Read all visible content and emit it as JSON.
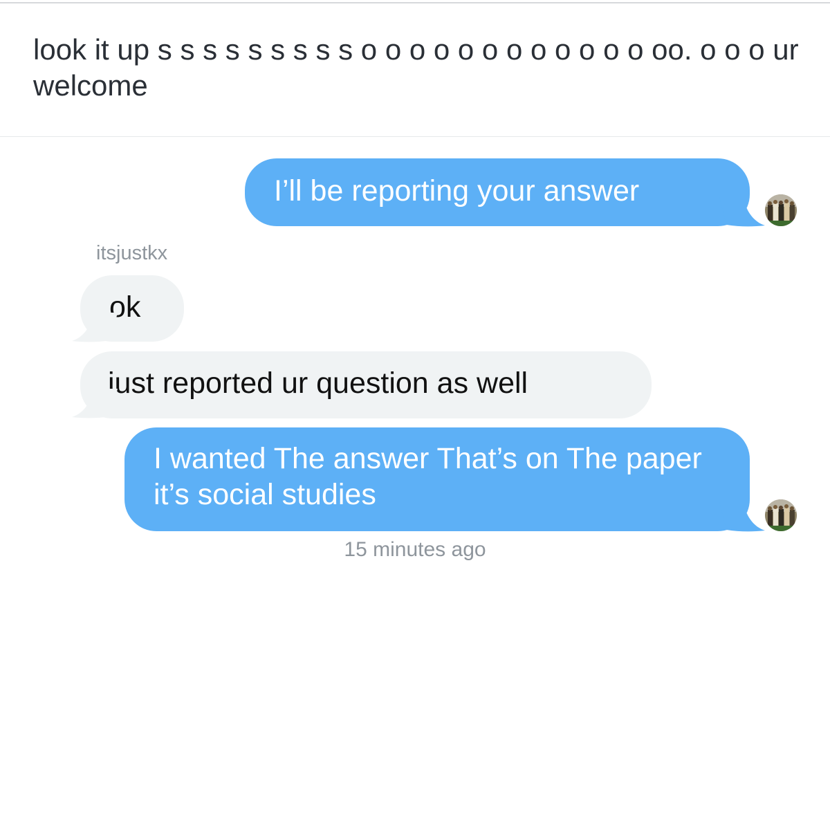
{
  "question": {
    "text": "look it up s s s s s s s s s o o o o o o o o o o o o oo. o o o ur welcome"
  },
  "conversation": {
    "messages": [
      {
        "sender": "me",
        "text": "I’ll be reporting your answer"
      },
      {
        "sender": "itsjustkx",
        "sender_label": "itsjustkx",
        "text": "ok"
      },
      {
        "sender": "itsjustkx",
        "text": "just reported ur question as well"
      },
      {
        "sender": "me",
        "text": "I wanted The answer That’s on The paper it’s social studies"
      }
    ],
    "timestamp": "15 minutes ago"
  },
  "colors": {
    "outgoing_bubble": "#5db0f6",
    "incoming_bubble": "#f0f3f4",
    "secondary_text": "#8e959c"
  },
  "icons": {
    "avatar": "user-avatar-photo"
  }
}
